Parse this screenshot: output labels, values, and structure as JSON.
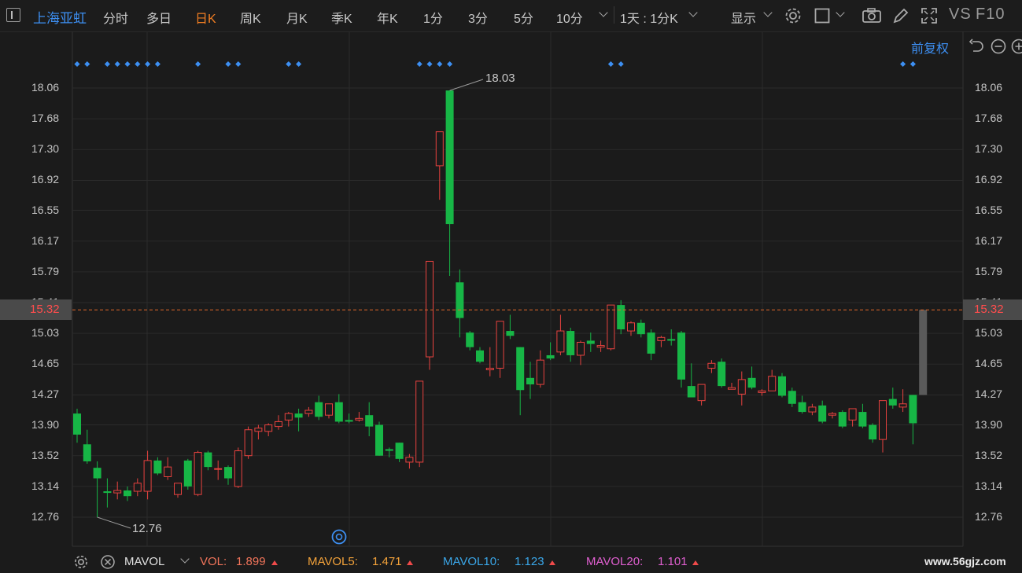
{
  "toolbar": {
    "stock_name": "上海亚虹",
    "periods": [
      "分时",
      "多日",
      "日K",
      "周K",
      "月K",
      "季K",
      "年K",
      "1分",
      "3分",
      "5分",
      "10分"
    ],
    "active_period": "日K",
    "range_select": "1天 : 1分K",
    "display_label": "显示",
    "vs_label": "VS",
    "f10_label": "F10"
  },
  "adjust_label": "前复权",
  "y_axis_labels": [
    "18.06",
    "17.68",
    "17.30",
    "16.92",
    "16.55",
    "16.17",
    "15.79",
    "15.41",
    "15.03",
    "14.65",
    "14.27",
    "13.90",
    "13.52",
    "13.14",
    "12.76"
  ],
  "current_price": "15.32",
  "high_annotation": "18.03",
  "low_annotation": "12.76",
  "indicators": {
    "main": "MAVOL",
    "vol_label": "VOL:",
    "vol_value": "1.899",
    "mavol5_label": "MAVOL5:",
    "mavol5_value": "1.471",
    "mavol10_label": "MAVOL10:",
    "mavol10_value": "1.123",
    "mavol20_label": "MAVOL20:",
    "mavol20_value": "1.101"
  },
  "watermark": "www.56gjz.com",
  "colors": {
    "up": "#e8423f",
    "down": "#17b646",
    "accent_blue": "#3d8ff2",
    "active_orange": "#f07d22",
    "price_line": "#e0662a"
  },
  "chart_data": {
    "type": "candlestick",
    "y_range": [
      12.5,
      18.25
    ],
    "y_ticks": [
      18.06,
      17.68,
      17.3,
      16.92,
      16.55,
      16.17,
      15.79,
      15.41,
      15.03,
      14.65,
      14.27,
      13.9,
      13.52,
      13.14,
      12.76
    ],
    "current_price": 15.32,
    "candles": [
      {
        "o": 14.04,
        "h": 14.1,
        "l": 13.68,
        "c": 13.78
      },
      {
        "o": 13.66,
        "h": 13.84,
        "l": 13.42,
        "c": 13.45
      },
      {
        "o": 13.37,
        "h": 13.45,
        "l": 12.76,
        "c": 13.24
      },
      {
        "o": 13.08,
        "h": 13.24,
        "l": 12.88,
        "c": 13.06
      },
      {
        "o": 13.06,
        "h": 13.2,
        "l": 12.98,
        "c": 13.09
      },
      {
        "o": 13.09,
        "h": 13.14,
        "l": 12.96,
        "c": 13.02
      },
      {
        "o": 13.08,
        "h": 13.24,
        "l": 13.02,
        "c": 13.18
      },
      {
        "o": 13.08,
        "h": 13.58,
        "l": 12.98,
        "c": 13.46
      },
      {
        "o": 13.46,
        "h": 13.5,
        "l": 13.28,
        "c": 13.3
      },
      {
        "o": 13.26,
        "h": 13.5,
        "l": 13.22,
        "c": 13.38
      },
      {
        "o": 13.04,
        "h": 13.16,
        "l": 13.0,
        "c": 13.18
      },
      {
        "o": 13.46,
        "h": 13.48,
        "l": 13.1,
        "c": 13.14
      },
      {
        "o": 13.04,
        "h": 13.58,
        "l": 13.02,
        "c": 13.56
      },
      {
        "o": 13.56,
        "h": 13.58,
        "l": 13.34,
        "c": 13.38
      },
      {
        "o": 13.36,
        "h": 13.46,
        "l": 13.22,
        "c": 13.36
      },
      {
        "o": 13.38,
        "h": 13.4,
        "l": 13.16,
        "c": 13.24
      },
      {
        "o": 13.14,
        "h": 13.62,
        "l": 13.12,
        "c": 13.58
      },
      {
        "o": 13.52,
        "h": 13.88,
        "l": 13.48,
        "c": 13.84
      },
      {
        "o": 13.82,
        "h": 13.9,
        "l": 13.72,
        "c": 13.86
      },
      {
        "o": 13.82,
        "h": 13.92,
        "l": 13.76,
        "c": 13.9
      },
      {
        "o": 13.88,
        "h": 14.02,
        "l": 13.84,
        "c": 13.94
      },
      {
        "o": 13.96,
        "h": 14.06,
        "l": 13.88,
        "c": 14.04
      },
      {
        "o": 14.04,
        "h": 14.1,
        "l": 13.82,
        "c": 13.99
      },
      {
        "o": 14.04,
        "h": 14.12,
        "l": 14.0,
        "c": 14.08
      },
      {
        "o": 14.18,
        "h": 14.26,
        "l": 13.96,
        "c": 14.0
      },
      {
        "o": 14.02,
        "h": 14.14,
        "l": 13.98,
        "c": 14.16
      },
      {
        "o": 14.18,
        "h": 14.28,
        "l": 13.92,
        "c": 13.94
      },
      {
        "o": 13.96,
        "h": 14.04,
        "l": 13.92,
        "c": 13.94
      },
      {
        "o": 13.96,
        "h": 14.06,
        "l": 13.94,
        "c": 13.98
      },
      {
        "o": 14.02,
        "h": 14.18,
        "l": 13.76,
        "c": 13.88
      },
      {
        "o": 13.9,
        "h": 13.94,
        "l": 13.52,
        "c": 13.52
      },
      {
        "o": 13.6,
        "h": 13.62,
        "l": 13.5,
        "c": 13.58
      },
      {
        "o": 13.68,
        "h": 13.68,
        "l": 13.44,
        "c": 13.48
      },
      {
        "o": 13.44,
        "h": 13.54,
        "l": 13.36,
        "c": 13.5
      },
      {
        "o": 13.44,
        "h": 14.36,
        "l": 13.38,
        "c": 14.44
      },
      {
        "o": 14.74,
        "h": 15.92,
        "l": 14.58,
        "c": 15.92
      },
      {
        "o": 17.1,
        "h": 17.52,
        "l": 16.68,
        "c": 17.52
      },
      {
        "o": 18.03,
        "h": 18.03,
        "l": 15.74,
        "c": 16.38
      },
      {
        "o": 15.66,
        "h": 15.82,
        "l": 14.98,
        "c": 15.22
      },
      {
        "o": 15.04,
        "h": 15.06,
        "l": 14.82,
        "c": 14.86
      },
      {
        "o": 14.82,
        "h": 14.86,
        "l": 14.66,
        "c": 14.68
      },
      {
        "o": 14.58,
        "h": 14.86,
        "l": 14.5,
        "c": 14.6
      },
      {
        "o": 14.6,
        "h": 15.18,
        "l": 14.48,
        "c": 15.18
      },
      {
        "o": 15.06,
        "h": 15.26,
        "l": 14.96,
        "c": 15.0
      },
      {
        "o": 14.86,
        "h": 14.86,
        "l": 14.02,
        "c": 14.33
      },
      {
        "o": 14.48,
        "h": 14.68,
        "l": 14.22,
        "c": 14.4
      },
      {
        "o": 14.4,
        "h": 14.82,
        "l": 14.36,
        "c": 14.7
      },
      {
        "o": 14.76,
        "h": 14.92,
        "l": 14.7,
        "c": 14.72
      },
      {
        "o": 14.8,
        "h": 15.26,
        "l": 14.76,
        "c": 15.06
      },
      {
        "o": 15.06,
        "h": 15.1,
        "l": 14.68,
        "c": 14.76
      },
      {
        "o": 14.76,
        "h": 14.94,
        "l": 14.64,
        "c": 14.92
      },
      {
        "o": 14.94,
        "h": 15.04,
        "l": 14.8,
        "c": 14.9
      },
      {
        "o": 14.86,
        "h": 14.94,
        "l": 14.8,
        "c": 14.88
      },
      {
        "o": 14.84,
        "h": 15.38,
        "l": 14.82,
        "c": 15.38
      },
      {
        "o": 15.38,
        "h": 15.44,
        "l": 15.02,
        "c": 15.08
      },
      {
        "o": 15.06,
        "h": 15.18,
        "l": 15.0,
        "c": 15.16
      },
      {
        "o": 15.16,
        "h": 15.2,
        "l": 14.98,
        "c": 15.02
      },
      {
        "o": 15.04,
        "h": 15.08,
        "l": 14.7,
        "c": 14.78
      },
      {
        "o": 14.94,
        "h": 15.0,
        "l": 14.86,
        "c": 14.98
      },
      {
        "o": 14.96,
        "h": 15.08,
        "l": 14.88,
        "c": 14.94
      },
      {
        "o": 15.04,
        "h": 15.06,
        "l": 14.36,
        "c": 14.46
      },
      {
        "o": 14.38,
        "h": 14.66,
        "l": 14.26,
        "c": 14.24
      },
      {
        "o": 14.2,
        "h": 14.4,
        "l": 14.14,
        "c": 14.4
      },
      {
        "o": 14.6,
        "h": 14.7,
        "l": 14.54,
        "c": 14.66
      },
      {
        "o": 14.68,
        "h": 14.72,
        "l": 14.36,
        "c": 14.38
      },
      {
        "o": 14.34,
        "h": 14.42,
        "l": 14.34,
        "c": 14.36
      },
      {
        "o": 14.28,
        "h": 14.56,
        "l": 14.14,
        "c": 14.46
      },
      {
        "o": 14.48,
        "h": 14.62,
        "l": 14.34,
        "c": 14.36
      },
      {
        "o": 14.3,
        "h": 14.34,
        "l": 14.26,
        "c": 14.32
      },
      {
        "o": 14.32,
        "h": 14.58,
        "l": 14.32,
        "c": 14.5
      },
      {
        "o": 14.5,
        "h": 14.54,
        "l": 14.24,
        "c": 14.26
      },
      {
        "o": 14.32,
        "h": 14.36,
        "l": 14.12,
        "c": 14.16
      },
      {
        "o": 14.18,
        "h": 14.26,
        "l": 14.04,
        "c": 14.06
      },
      {
        "o": 14.06,
        "h": 14.16,
        "l": 14.02,
        "c": 14.12
      },
      {
        "o": 14.14,
        "h": 14.2,
        "l": 13.92,
        "c": 13.94
      },
      {
        "o": 14.02,
        "h": 14.06,
        "l": 13.98,
        "c": 14.04
      },
      {
        "o": 14.06,
        "h": 14.08,
        "l": 13.86,
        "c": 13.88
      },
      {
        "o": 13.96,
        "h": 14.1,
        "l": 13.88,
        "c": 14.1
      },
      {
        "o": 14.06,
        "h": 14.16,
        "l": 13.86,
        "c": 13.88
      },
      {
        "o": 13.9,
        "h": 13.92,
        "l": 13.68,
        "c": 13.72
      },
      {
        "o": 13.72,
        "h": 14.2,
        "l": 13.56,
        "c": 14.2
      },
      {
        "o": 14.22,
        "h": 14.36,
        "l": 14.1,
        "c": 14.14
      },
      {
        "o": 14.12,
        "h": 14.34,
        "l": 14.06,
        "c": 14.16
      },
      {
        "o": 14.27,
        "h": 14.27,
        "l": 13.66,
        "c": 13.92
      },
      {
        "o": 14.27,
        "h": 15.32,
        "l": 14.27,
        "c": 15.32,
        "live": true
      }
    ],
    "markers_x_index": [
      0,
      1,
      3,
      4,
      5,
      6,
      7,
      8,
      12,
      15,
      16,
      21,
      22,
      34,
      35,
      36,
      37,
      53,
      54,
      82,
      83
    ]
  }
}
